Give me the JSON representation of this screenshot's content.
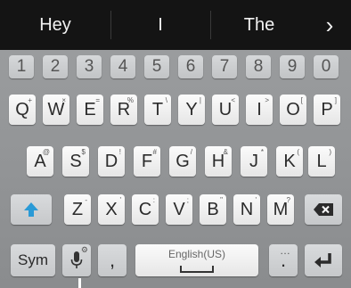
{
  "suggestions": {
    "items": [
      "Hey",
      "I",
      "The"
    ],
    "more_glyph": "›"
  },
  "keyboard": {
    "number_row": [
      "1",
      "2",
      "3",
      "4",
      "5",
      "6",
      "7",
      "8",
      "9",
      "0"
    ],
    "row_q": [
      {
        "label": "Q",
        "hint": "+"
      },
      {
        "label": "W",
        "hint": "×"
      },
      {
        "label": "E",
        "hint": "="
      },
      {
        "label": "R",
        "hint": "%"
      },
      {
        "label": "T",
        "hint": "\\"
      },
      {
        "label": "Y",
        "hint": "|"
      },
      {
        "label": "U",
        "hint": "<"
      },
      {
        "label": "I",
        "hint": ">"
      },
      {
        "label": "O",
        "hint": "["
      },
      {
        "label": "P",
        "hint": "]"
      }
    ],
    "row_a": [
      {
        "label": "A",
        "hint": "@"
      },
      {
        "label": "S",
        "hint": "$"
      },
      {
        "label": "D",
        "hint": "!"
      },
      {
        "label": "F",
        "hint": "#"
      },
      {
        "label": "G",
        "hint": "/"
      },
      {
        "label": "H",
        "hint": "&"
      },
      {
        "label": "J",
        "hint": "*"
      },
      {
        "label": "K",
        "hint": "("
      },
      {
        "label": "L",
        "hint": ")"
      }
    ],
    "row_z": [
      {
        "label": "Z",
        "hint": "-"
      },
      {
        "label": "X",
        "hint": "'"
      },
      {
        "label": "C",
        "hint": ":"
      },
      {
        "label": "V",
        "hint": ";"
      },
      {
        "label": "B",
        "hint": "\""
      },
      {
        "label": "N",
        "hint": "'"
      },
      {
        "label": "M",
        "hint": "?"
      }
    ],
    "sym_label": "Sym",
    "comma_label": ",",
    "space_label": "English(US)",
    "period_label": ".",
    "period_hint": "…",
    "shift_icon": "shift-arrow-up",
    "backspace_icon": "backspace",
    "mic_icon": "microphone",
    "enter_icon": "enter-return",
    "accent_color": "#2a9ad6"
  }
}
